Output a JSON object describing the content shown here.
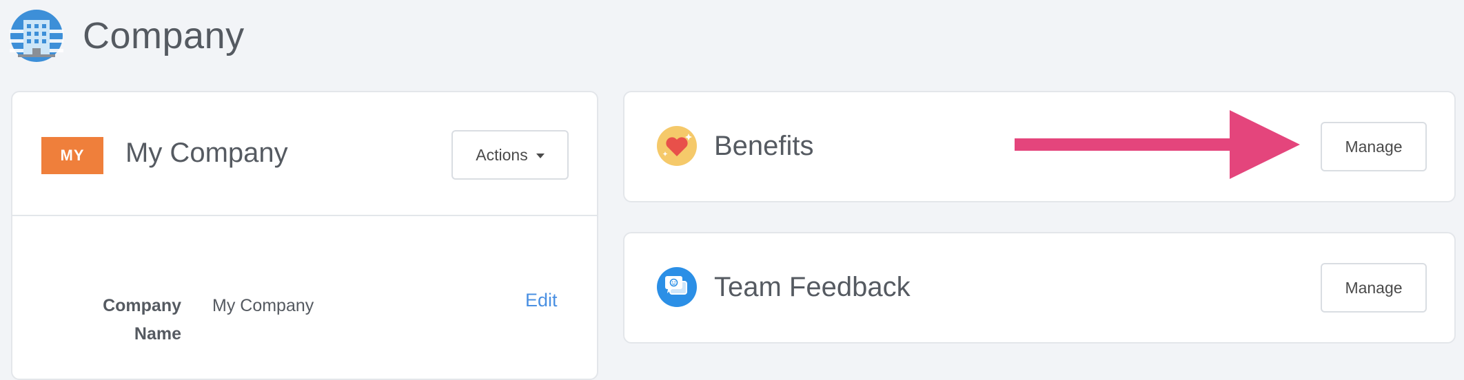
{
  "header": {
    "title": "Company",
    "icon": "building-icon"
  },
  "company_card": {
    "badge": "MY",
    "name": "My Company",
    "actions_label": "Actions",
    "fields": [
      {
        "label": "Company Name",
        "value": "My Company",
        "action": "Edit"
      }
    ]
  },
  "services": [
    {
      "title": "Benefits",
      "icon": "heart-icon",
      "button": "Manage"
    },
    {
      "title": "Team Feedback",
      "icon": "chat-icon",
      "button": "Manage"
    }
  ],
  "colors": {
    "badge": "#ef7f3b",
    "link": "#4a90e2",
    "arrow": "#e4457c",
    "background": "#f2f4f7"
  }
}
